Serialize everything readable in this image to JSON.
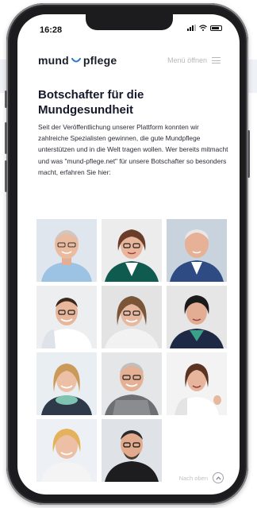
{
  "status": {
    "time": "16:28"
  },
  "header": {
    "logo_left": "mund",
    "logo_right": "pflege",
    "menu_label": "Menü öffnen"
  },
  "main": {
    "title": "Botschafter für die Mundgesundheit",
    "intro": "Seit der Veröffentlichung unserer Plattform konnten wir zahlreiche Spezialisten gewinnen, die gute Mundpflege unterstützen und in die Welt tragen wollen. Wer bereits mitmacht und was \"mund-pflege.net\" für unsere Botschafter so besonders macht, erfahren Sie hier:"
  },
  "footer": {
    "more_label": "Nach oben"
  },
  "colors": {
    "logo_smile": "#2e7bcf",
    "title": "#16192a",
    "muted": "#b8b8b8"
  },
  "icons": [
    "signal-icon",
    "wifi-icon",
    "battery-icon",
    "hamburger-menu-icon",
    "chevron-up-icon"
  ]
}
